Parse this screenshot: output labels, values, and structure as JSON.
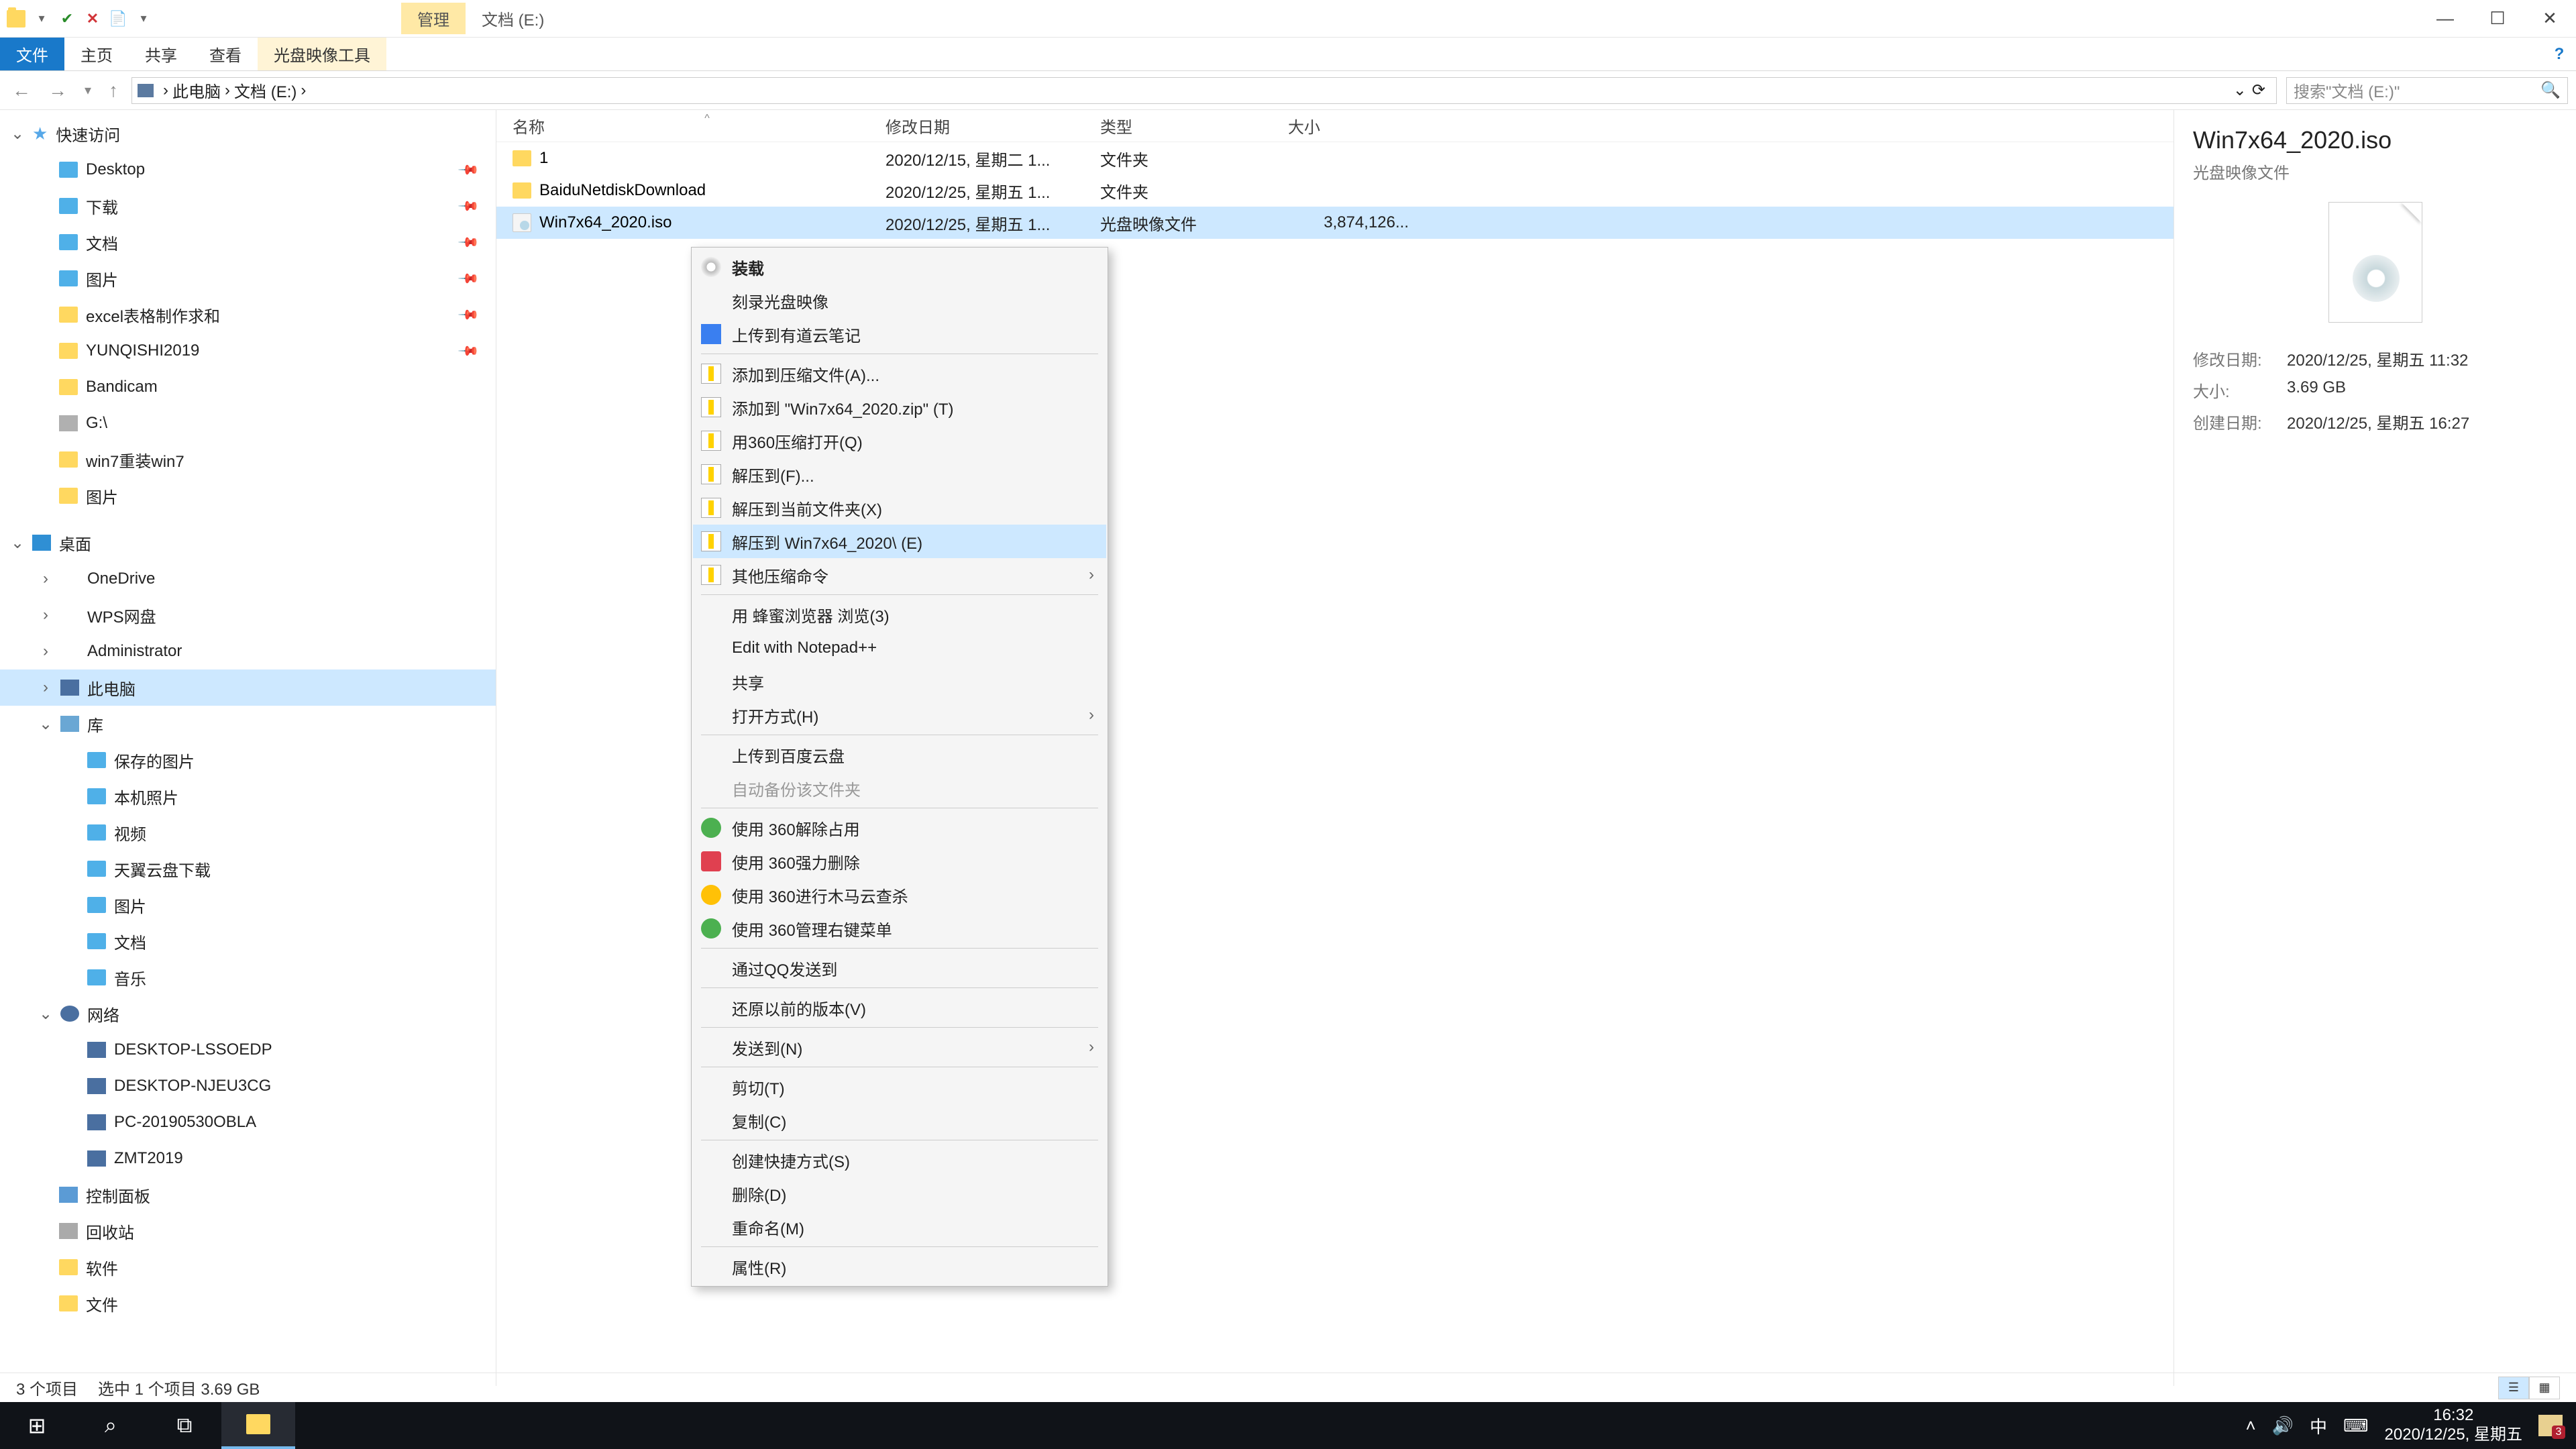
{
  "titlebar": {
    "contextual_tab": "管理",
    "title": "文档 (E:)"
  },
  "ribbon": {
    "tabs": [
      "文件",
      "主页",
      "共享",
      "查看"
    ],
    "contextual": "光盘映像工具"
  },
  "breadcrumb": {
    "parts": [
      "此电脑",
      "文档 (E:)"
    ],
    "search_placeholder": "搜索\"文档 (E:)\""
  },
  "tree": {
    "quick_access": "快速访问",
    "qa_items": [
      {
        "label": "Desktop",
        "pin": true,
        "icon": "ic-folder-blue"
      },
      {
        "label": "下载",
        "pin": true,
        "icon": "ic-folder-blue"
      },
      {
        "label": "文档",
        "pin": true,
        "icon": "ic-folder-blue"
      },
      {
        "label": "图片",
        "pin": true,
        "icon": "ic-folder-blue"
      },
      {
        "label": "excel表格制作求和",
        "pin": true,
        "icon": "ic-folder"
      },
      {
        "label": "YUNQISHI2019",
        "pin": true,
        "icon": "ic-folder"
      },
      {
        "label": "Bandicam",
        "pin": false,
        "icon": "ic-folder"
      },
      {
        "label": "G:\\",
        "pin": false,
        "icon": "ic-drive"
      },
      {
        "label": "win7重装win7",
        "pin": false,
        "icon": "ic-folder"
      },
      {
        "label": "图片",
        "pin": false,
        "icon": "ic-folder"
      }
    ],
    "desktop": "桌面",
    "desktop_items": [
      {
        "label": "OneDrive",
        "icon": "ic-onedrive"
      },
      {
        "label": "WPS网盘",
        "icon": "ic-wps"
      },
      {
        "label": "Administrator",
        "icon": "ic-user"
      },
      {
        "label": "此电脑",
        "icon": "ic-pc",
        "sel": true
      },
      {
        "label": "库",
        "icon": "ic-lib"
      }
    ],
    "lib_items": [
      {
        "label": "保存的图片"
      },
      {
        "label": "本机照片"
      },
      {
        "label": "视频"
      },
      {
        "label": "天翼云盘下载"
      },
      {
        "label": "图片"
      },
      {
        "label": "文档"
      },
      {
        "label": "音乐"
      }
    ],
    "network": "网络",
    "net_items": [
      {
        "label": "DESKTOP-LSSOEDP"
      },
      {
        "label": "DESKTOP-NJEU3CG"
      },
      {
        "label": "PC-20190530OBLA"
      },
      {
        "label": "ZMT2019"
      }
    ],
    "others": [
      {
        "label": "控制面板",
        "icon": "ic-cpanel"
      },
      {
        "label": "回收站",
        "icon": "ic-recycle"
      },
      {
        "label": "软件",
        "icon": "ic-folder"
      },
      {
        "label": "文件",
        "icon": "ic-folder"
      }
    ]
  },
  "columns": {
    "name": "名称",
    "date": "修改日期",
    "type": "类型",
    "size": "大小"
  },
  "rows": [
    {
      "name": "1",
      "date": "2020/12/15, 星期二 1...",
      "type": "文件夹",
      "size": "",
      "icon": "fic-folder"
    },
    {
      "name": "BaiduNetdiskDownload",
      "date": "2020/12/25, 星期五 1...",
      "type": "文件夹",
      "size": "",
      "icon": "fic-folder"
    },
    {
      "name": "Win7x64_2020.iso",
      "date": "2020/12/25, 星期五 1...",
      "type": "光盘映像文件",
      "size": "3,874,126...",
      "icon": "fic-iso",
      "sel": true
    }
  ],
  "context": [
    {
      "t": "item",
      "label": "装载",
      "bold": true,
      "icon": "disc"
    },
    {
      "t": "item",
      "label": "刻录光盘映像"
    },
    {
      "t": "item",
      "label": "上传到有道云笔记",
      "icon": "note"
    },
    {
      "t": "sep"
    },
    {
      "t": "item",
      "label": "添加到压缩文件(A)...",
      "icon": "zip"
    },
    {
      "t": "item",
      "label": "添加到 \"Win7x64_2020.zip\" (T)",
      "icon": "zip"
    },
    {
      "t": "item",
      "label": "用360压缩打开(Q)",
      "icon": "zip"
    },
    {
      "t": "item",
      "label": "解压到(F)...",
      "icon": "zip"
    },
    {
      "t": "item",
      "label": "解压到当前文件夹(X)",
      "icon": "zip"
    },
    {
      "t": "item",
      "label": "解压到 Win7x64_2020\\ (E)",
      "icon": "zip",
      "hov": true
    },
    {
      "t": "item",
      "label": "其他压缩命令",
      "icon": "zip",
      "sub": true
    },
    {
      "t": "sep"
    },
    {
      "t": "item",
      "label": "用 蜂蜜浏览器 浏览(3)"
    },
    {
      "t": "item",
      "label": "Edit with Notepad++",
      "icon": "np"
    },
    {
      "t": "item",
      "label": "共享",
      "icon": "share"
    },
    {
      "t": "item",
      "label": "打开方式(H)",
      "sub": true
    },
    {
      "t": "sep"
    },
    {
      "t": "item",
      "label": "上传到百度云盘",
      "icon": "cloud"
    },
    {
      "t": "item",
      "label": "自动备份该文件夹",
      "disabled": true
    },
    {
      "t": "sep"
    },
    {
      "t": "item",
      "label": "使用 360解除占用",
      "icon": "s360"
    },
    {
      "t": "item",
      "label": "使用 360强力删除",
      "icon": "s360r"
    },
    {
      "t": "item",
      "label": "使用 360进行木马云查杀",
      "icon": "s360y"
    },
    {
      "t": "item",
      "label": "使用 360管理右键菜单",
      "icon": "s360b"
    },
    {
      "t": "sep"
    },
    {
      "t": "item",
      "label": "通过QQ发送到"
    },
    {
      "t": "sep"
    },
    {
      "t": "item",
      "label": "还原以前的版本(V)"
    },
    {
      "t": "sep"
    },
    {
      "t": "item",
      "label": "发送到(N)",
      "sub": true
    },
    {
      "t": "sep"
    },
    {
      "t": "item",
      "label": "剪切(T)"
    },
    {
      "t": "item",
      "label": "复制(C)"
    },
    {
      "t": "sep"
    },
    {
      "t": "item",
      "label": "创建快捷方式(S)"
    },
    {
      "t": "item",
      "label": "删除(D)"
    },
    {
      "t": "item",
      "label": "重命名(M)"
    },
    {
      "t": "sep"
    },
    {
      "t": "item",
      "label": "属性(R)"
    }
  ],
  "details": {
    "title": "Win7x64_2020.iso",
    "subtitle": "光盘映像文件",
    "rows": [
      {
        "label": "修改日期:",
        "value": "2020/12/25, 星期五 11:32"
      },
      {
        "label": "大小:",
        "value": "3.69 GB"
      },
      {
        "label": "创建日期:",
        "value": "2020/12/25, 星期五 16:27"
      }
    ]
  },
  "status": {
    "count": "3 个项目",
    "selection": "选中 1 个项目  3.69 GB"
  },
  "taskbar": {
    "time": "16:32",
    "date": "2020/12/25, 星期五",
    "ime": "中",
    "notif": "3"
  }
}
